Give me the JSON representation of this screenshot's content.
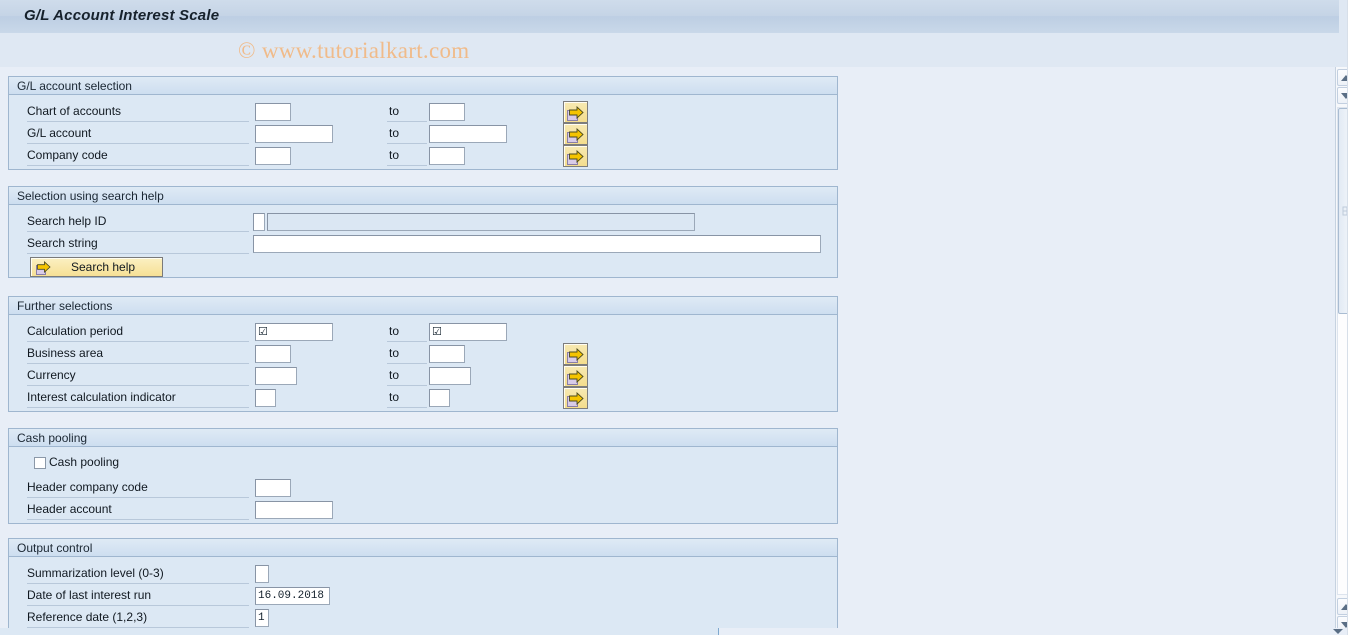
{
  "window": {
    "title": "G/L Account Interest Scale",
    "watermark": "© www.tutorialkart.com"
  },
  "groups": [
    {
      "id": "gl-account-selection",
      "title": "G/L account selection",
      "rows": [
        {
          "label": "Chart of accounts",
          "to_label": "to",
          "from_value": "",
          "to_value": "",
          "has_arrow_button": true
        },
        {
          "label": "G/L account",
          "to_label": "to",
          "from_value": "",
          "to_value": "",
          "has_arrow_button": true
        },
        {
          "label": "Company code",
          "to_label": "to",
          "from_value": "",
          "to_value": "",
          "has_arrow_button": true
        }
      ]
    },
    {
      "id": "selection-using-search-help",
      "title": "Selection using search help",
      "rows": [
        {
          "label": "Search help ID",
          "from_value": "",
          "readonly_value": ""
        },
        {
          "label": "Search string",
          "from_value": ""
        }
      ],
      "button": {
        "label": "Search help",
        "icon": "arrow-right-icon"
      }
    },
    {
      "id": "further-selections",
      "title": "Further selections",
      "rows": [
        {
          "label": "Calculation period",
          "to_label": "to",
          "from_value": "☑",
          "to_value": "☑",
          "has_arrow_button": false
        },
        {
          "label": "Business area",
          "to_label": "to",
          "from_value": "",
          "to_value": "",
          "has_arrow_button": true
        },
        {
          "label": "Currency",
          "to_label": "to",
          "from_value": "",
          "to_value": "",
          "has_arrow_button": true
        },
        {
          "label": "Interest calculation indicator",
          "to_label": "to",
          "from_value": "",
          "to_value": "",
          "has_arrow_button": true
        }
      ]
    },
    {
      "id": "cash-pooling",
      "title": "Cash pooling",
      "checkbox": {
        "label": "Cash pooling",
        "checked": false
      },
      "rows": [
        {
          "label": "Header company code",
          "from_value": ""
        },
        {
          "label": "Header account",
          "from_value": ""
        }
      ]
    },
    {
      "id": "output-control",
      "title": "Output control",
      "rows": [
        {
          "label": "Summarization level (0-3)",
          "from_value": ""
        },
        {
          "label": "Date of last interest run",
          "from_value": "16.09.2018"
        },
        {
          "label": "Reference date (1,2,3)",
          "from_value": "1"
        }
      ]
    }
  ],
  "scrollbar": {
    "up_icon": "triangle-up-icon",
    "down_icon": "triangle-down-icon",
    "grip_icon": "scroll-grip-icon"
  },
  "colors": {
    "accent": "#c5d4e6",
    "panel": "#dce8f4",
    "canvas": "#e8eef7",
    "button_yellow": "#f4dd8d",
    "watermark": "#f0bb8a"
  }
}
